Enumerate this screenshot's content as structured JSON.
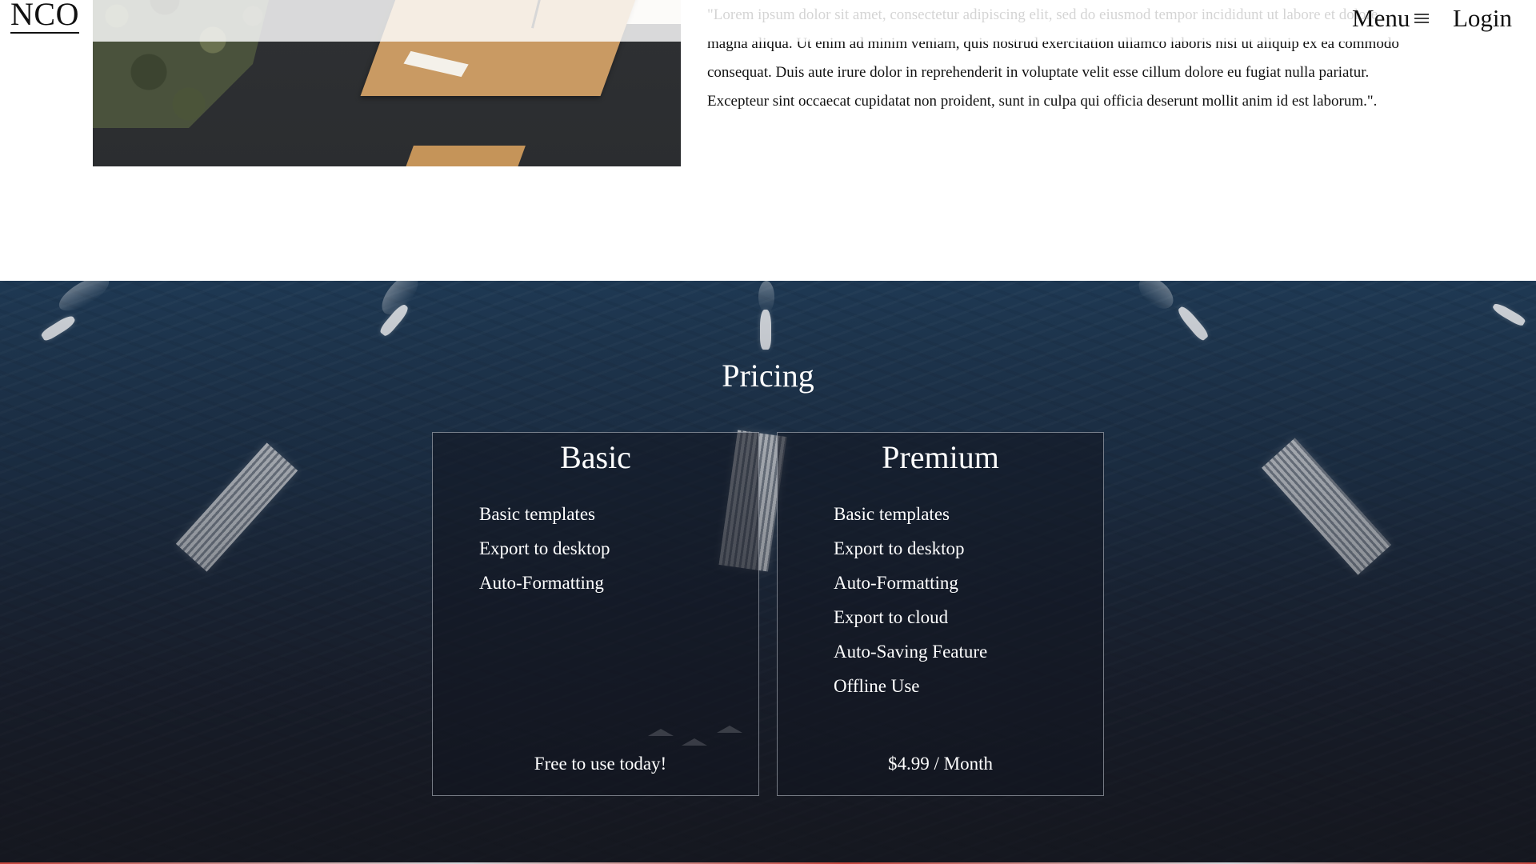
{
  "header": {
    "logo": "NCO",
    "menu_label": "Menu",
    "menu_icon": "hamburger-icon",
    "login_label": "Login"
  },
  "about": {
    "image": "military-paperwork-photo",
    "paragraph": "\"Lorem ipsum dolor sit amet, consectetur adipiscing elit, sed do eiusmod tempor incididunt ut labore et dolore magna aliqua. Ut enim ad minim veniam, quis nostrud exercitation ullamco laboris nisi ut aliquip ex ea commodo consequat. Duis aute irure dolor in reprehenderit in voluptate velit esse cillum dolore eu fugiat nulla pariatur. Excepteur sint occaecat cupidatat non proident, sunt in culpa qui officia deserunt mollit anim id est laborum.\"."
  },
  "pricing": {
    "background_image": "naval-fleet-aerial-photo",
    "title": "Pricing",
    "plans": [
      {
        "name": "Basic",
        "features": [
          "Basic templates",
          "Export to desktop",
          "Auto-Formatting"
        ],
        "price": "Free to use today!"
      },
      {
        "name": "Premium",
        "features": [
          "Basic templates",
          "Export to desktop",
          "Auto-Formatting",
          "Export to cloud",
          "Auto-Saving Feature",
          "Offline Use"
        ],
        "price": "$4.99 / Month"
      }
    ]
  },
  "colors": {
    "text_dark": "#111111",
    "text_light": "#ffffff",
    "card_border": "#c8cdd7",
    "ocean": "#1c3149"
  }
}
